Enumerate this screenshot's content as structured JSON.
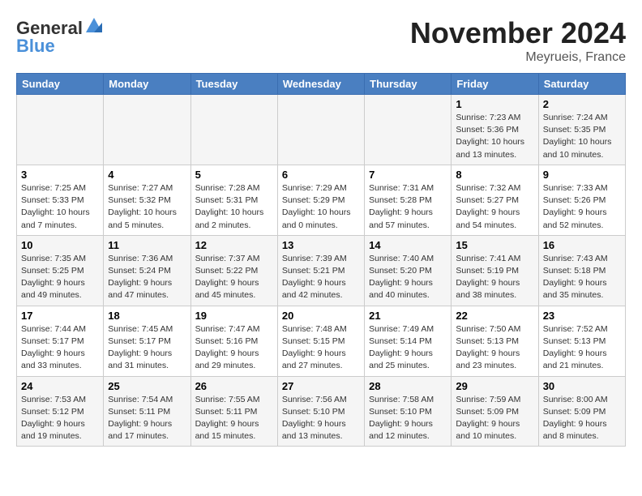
{
  "header": {
    "logo_general": "General",
    "logo_blue": "Blue",
    "month": "November 2024",
    "location": "Meyrueis, France"
  },
  "weekdays": [
    "Sunday",
    "Monday",
    "Tuesday",
    "Wednesday",
    "Thursday",
    "Friday",
    "Saturday"
  ],
  "weeks": [
    [
      {
        "day": "",
        "info": ""
      },
      {
        "day": "",
        "info": ""
      },
      {
        "day": "",
        "info": ""
      },
      {
        "day": "",
        "info": ""
      },
      {
        "day": "",
        "info": ""
      },
      {
        "day": "1",
        "info": "Sunrise: 7:23 AM\nSunset: 5:36 PM\nDaylight: 10 hours\nand 13 minutes."
      },
      {
        "day": "2",
        "info": "Sunrise: 7:24 AM\nSunset: 5:35 PM\nDaylight: 10 hours\nand 10 minutes."
      }
    ],
    [
      {
        "day": "3",
        "info": "Sunrise: 7:25 AM\nSunset: 5:33 PM\nDaylight: 10 hours\nand 7 minutes."
      },
      {
        "day": "4",
        "info": "Sunrise: 7:27 AM\nSunset: 5:32 PM\nDaylight: 10 hours\nand 5 minutes."
      },
      {
        "day": "5",
        "info": "Sunrise: 7:28 AM\nSunset: 5:31 PM\nDaylight: 10 hours\nand 2 minutes."
      },
      {
        "day": "6",
        "info": "Sunrise: 7:29 AM\nSunset: 5:29 PM\nDaylight: 10 hours\nand 0 minutes."
      },
      {
        "day": "7",
        "info": "Sunrise: 7:31 AM\nSunset: 5:28 PM\nDaylight: 9 hours\nand 57 minutes."
      },
      {
        "day": "8",
        "info": "Sunrise: 7:32 AM\nSunset: 5:27 PM\nDaylight: 9 hours\nand 54 minutes."
      },
      {
        "day": "9",
        "info": "Sunrise: 7:33 AM\nSunset: 5:26 PM\nDaylight: 9 hours\nand 52 minutes."
      }
    ],
    [
      {
        "day": "10",
        "info": "Sunrise: 7:35 AM\nSunset: 5:25 PM\nDaylight: 9 hours\nand 49 minutes."
      },
      {
        "day": "11",
        "info": "Sunrise: 7:36 AM\nSunset: 5:24 PM\nDaylight: 9 hours\nand 47 minutes."
      },
      {
        "day": "12",
        "info": "Sunrise: 7:37 AM\nSunset: 5:22 PM\nDaylight: 9 hours\nand 45 minutes."
      },
      {
        "day": "13",
        "info": "Sunrise: 7:39 AM\nSunset: 5:21 PM\nDaylight: 9 hours\nand 42 minutes."
      },
      {
        "day": "14",
        "info": "Sunrise: 7:40 AM\nSunset: 5:20 PM\nDaylight: 9 hours\nand 40 minutes."
      },
      {
        "day": "15",
        "info": "Sunrise: 7:41 AM\nSunset: 5:19 PM\nDaylight: 9 hours\nand 38 minutes."
      },
      {
        "day": "16",
        "info": "Sunrise: 7:43 AM\nSunset: 5:18 PM\nDaylight: 9 hours\nand 35 minutes."
      }
    ],
    [
      {
        "day": "17",
        "info": "Sunrise: 7:44 AM\nSunset: 5:17 PM\nDaylight: 9 hours\nand 33 minutes."
      },
      {
        "day": "18",
        "info": "Sunrise: 7:45 AM\nSunset: 5:17 PM\nDaylight: 9 hours\nand 31 minutes."
      },
      {
        "day": "19",
        "info": "Sunrise: 7:47 AM\nSunset: 5:16 PM\nDaylight: 9 hours\nand 29 minutes."
      },
      {
        "day": "20",
        "info": "Sunrise: 7:48 AM\nSunset: 5:15 PM\nDaylight: 9 hours\nand 27 minutes."
      },
      {
        "day": "21",
        "info": "Sunrise: 7:49 AM\nSunset: 5:14 PM\nDaylight: 9 hours\nand 25 minutes."
      },
      {
        "day": "22",
        "info": "Sunrise: 7:50 AM\nSunset: 5:13 PM\nDaylight: 9 hours\nand 23 minutes."
      },
      {
        "day": "23",
        "info": "Sunrise: 7:52 AM\nSunset: 5:13 PM\nDaylight: 9 hours\nand 21 minutes."
      }
    ],
    [
      {
        "day": "24",
        "info": "Sunrise: 7:53 AM\nSunset: 5:12 PM\nDaylight: 9 hours\nand 19 minutes."
      },
      {
        "day": "25",
        "info": "Sunrise: 7:54 AM\nSunset: 5:11 PM\nDaylight: 9 hours\nand 17 minutes."
      },
      {
        "day": "26",
        "info": "Sunrise: 7:55 AM\nSunset: 5:11 PM\nDaylight: 9 hours\nand 15 minutes."
      },
      {
        "day": "27",
        "info": "Sunrise: 7:56 AM\nSunset: 5:10 PM\nDaylight: 9 hours\nand 13 minutes."
      },
      {
        "day": "28",
        "info": "Sunrise: 7:58 AM\nSunset: 5:10 PM\nDaylight: 9 hours\nand 12 minutes."
      },
      {
        "day": "29",
        "info": "Sunrise: 7:59 AM\nSunset: 5:09 PM\nDaylight: 9 hours\nand 10 minutes."
      },
      {
        "day": "30",
        "info": "Sunrise: 8:00 AM\nSunset: 5:09 PM\nDaylight: 9 hours\nand 8 minutes."
      }
    ]
  ]
}
